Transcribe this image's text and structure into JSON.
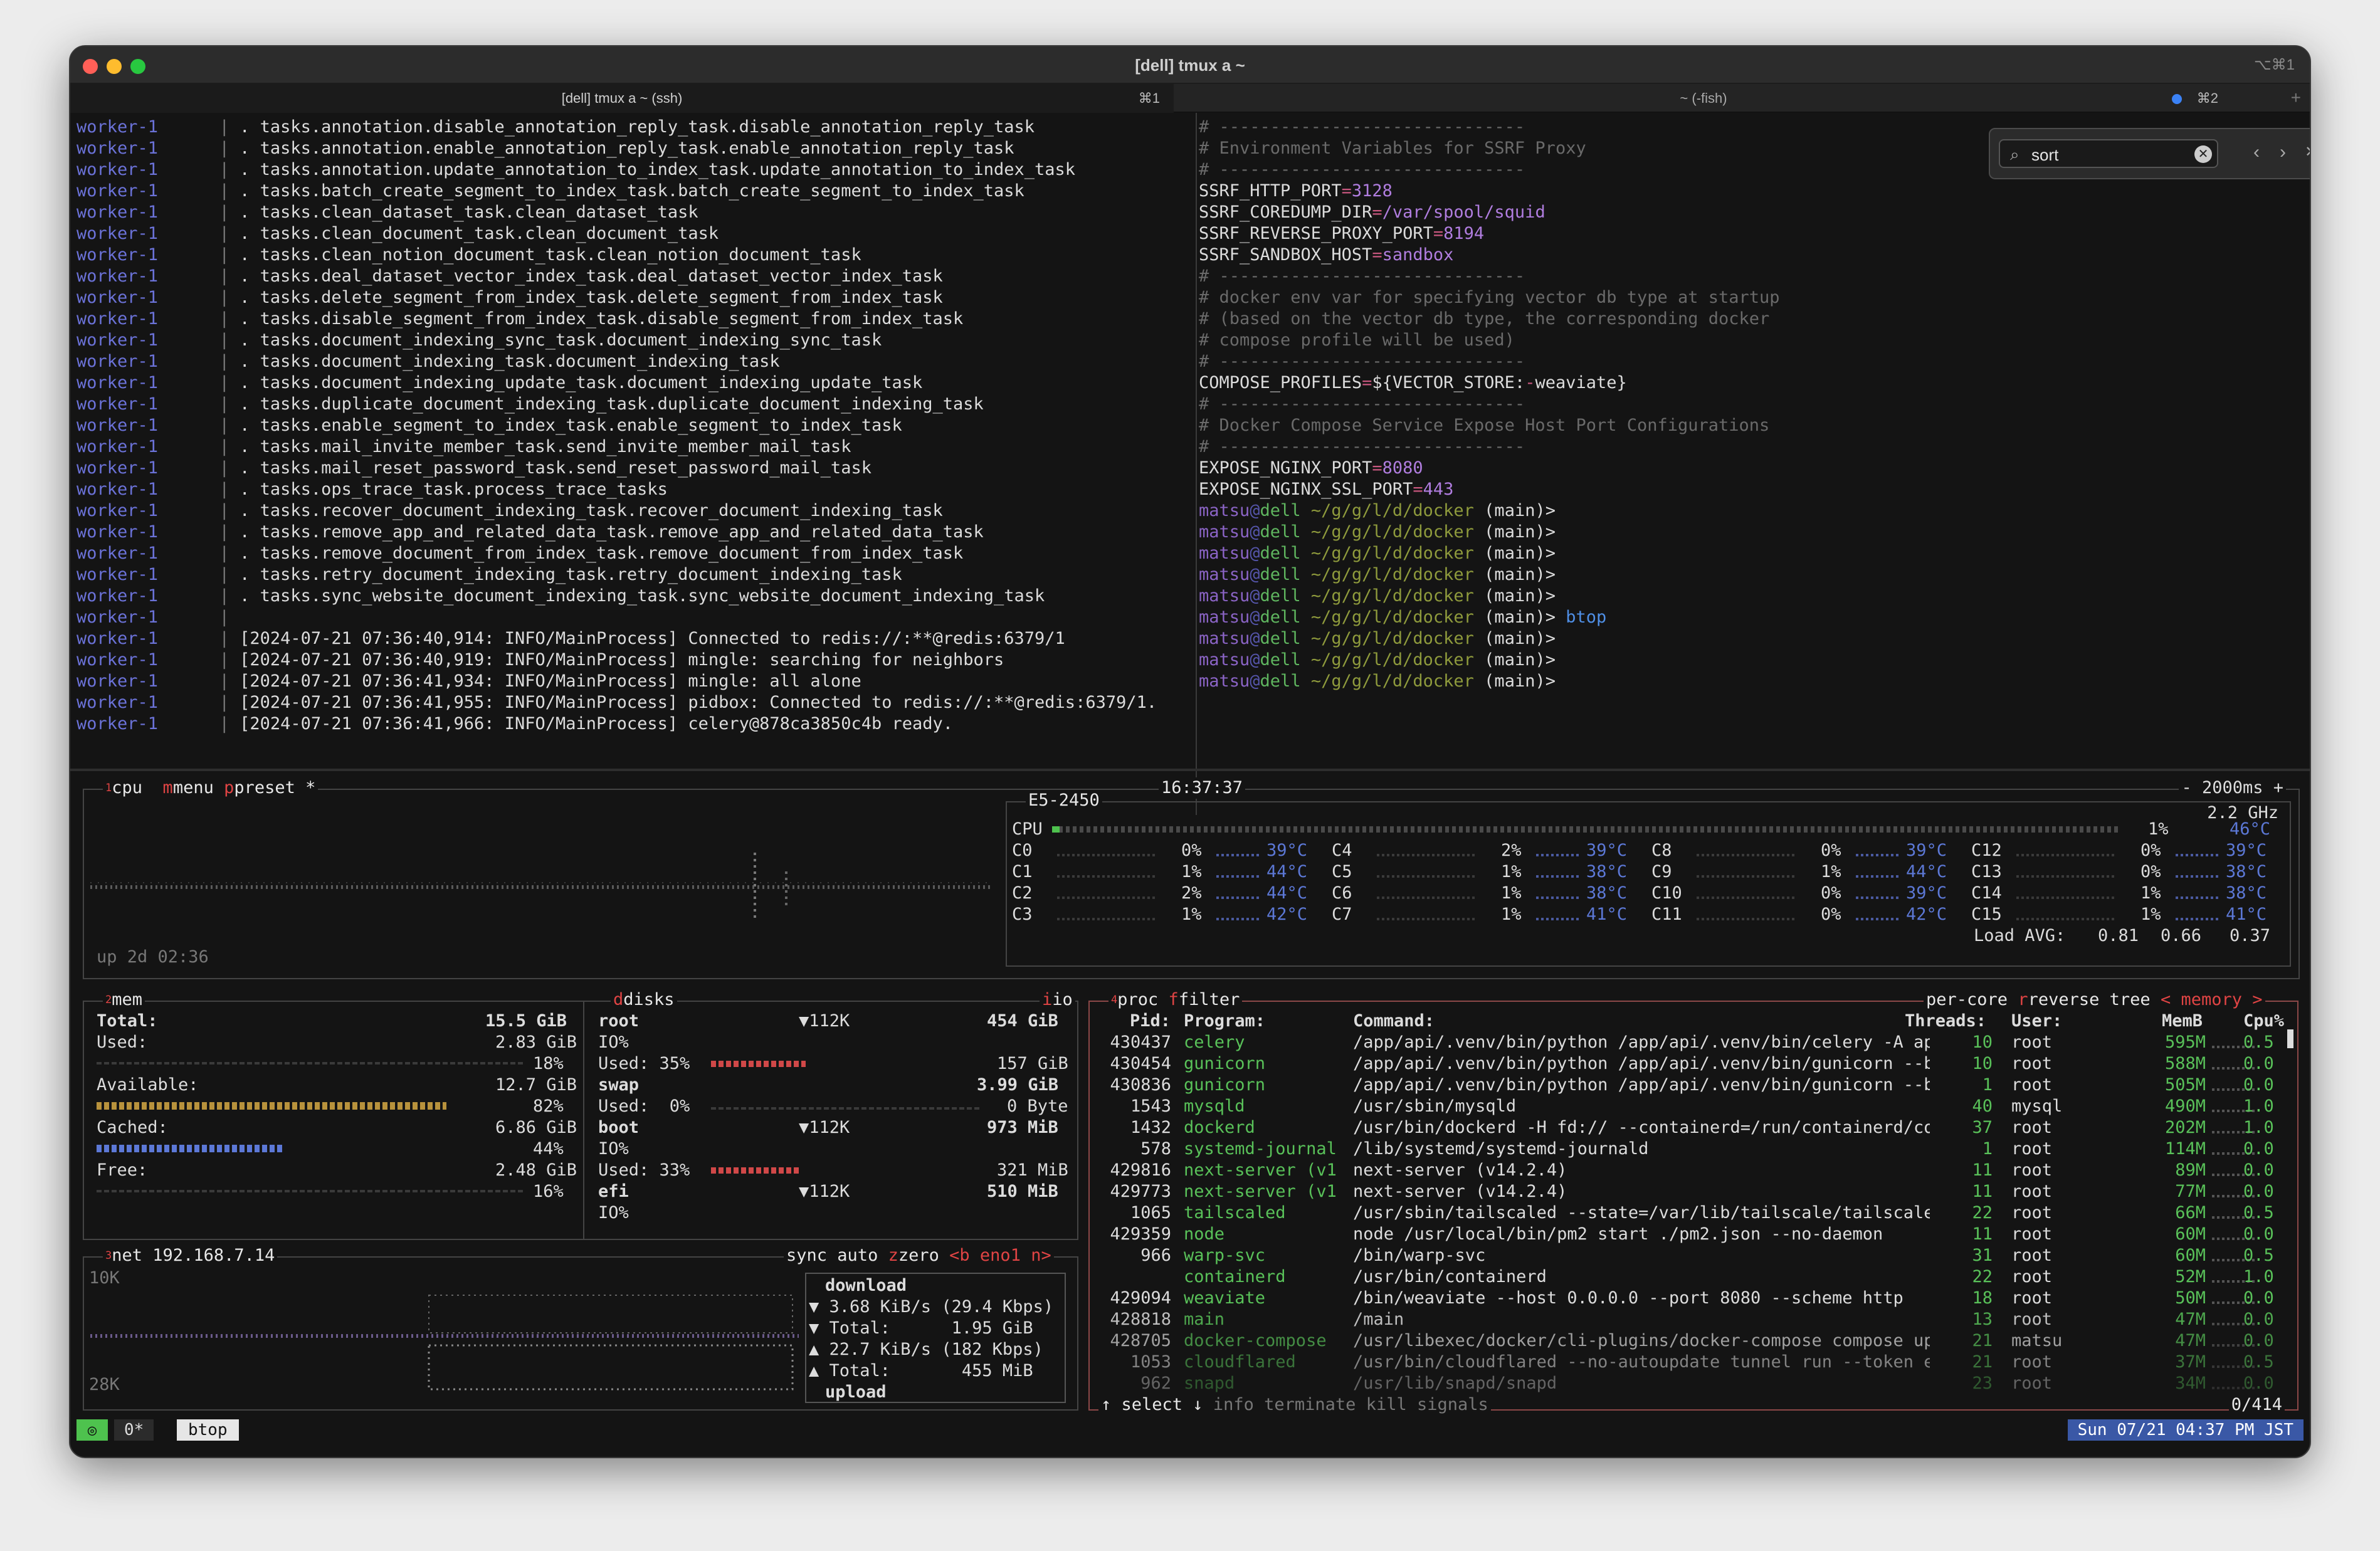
{
  "window": {
    "title": "[dell] tmux a ~",
    "shortcut": "⌥⌘1"
  },
  "tabs": [
    {
      "label": "[dell] tmux a ~ (ssh)",
      "key": "⌘1"
    },
    {
      "label": "~ (-fish)",
      "key": "⌘2"
    }
  ],
  "tab_plus": "+",
  "search": {
    "value": "sort",
    "clear": "✕",
    "prev": "‹",
    "next": "›",
    "close": "✕"
  },
  "left_pane": {
    "prefix": "worker-1",
    "sep": "|",
    "tasks": [
      ". tasks.annotation.disable_annotation_reply_task.disable_annotation_reply_task",
      ". tasks.annotation.enable_annotation_reply_task.enable_annotation_reply_task",
      ". tasks.annotation.update_annotation_to_index_task.update_annotation_to_index_task",
      ". tasks.batch_create_segment_to_index_task.batch_create_segment_to_index_task",
      ". tasks.clean_dataset_task.clean_dataset_task",
      ". tasks.clean_document_task.clean_document_task",
      ". tasks.clean_notion_document_task.clean_notion_document_task",
      ". tasks.deal_dataset_vector_index_task.deal_dataset_vector_index_task",
      ". tasks.delete_segment_from_index_task.delete_segment_from_index_task",
      ". tasks.disable_segment_from_index_task.disable_segment_from_index_task",
      ". tasks.document_indexing_sync_task.document_indexing_sync_task",
      ". tasks.document_indexing_task.document_indexing_task",
      ". tasks.document_indexing_update_task.document_indexing_update_task",
      ". tasks.duplicate_document_indexing_task.duplicate_document_indexing_task",
      ". tasks.enable_segment_to_index_task.enable_segment_to_index_task",
      ". tasks.mail_invite_member_task.send_invite_member_mail_task",
      ". tasks.mail_reset_password_task.send_reset_password_mail_task",
      ". tasks.ops_trace_task.process_trace_tasks",
      ". tasks.recover_document_indexing_task.recover_document_indexing_task",
      ". tasks.remove_app_and_related_data_task.remove_app_and_related_data_task",
      ". tasks.remove_document_from_index_task.remove_document_from_index_task",
      ". tasks.retry_document_indexing_task.retry_document_indexing_task",
      ". tasks.sync_website_document_indexing_task.sync_website_document_indexing_task",
      "",
      "[2024-07-21 07:36:40,914: INFO/MainProcess] Connected to redis://:**@redis:6379/1",
      "[2024-07-21 07:36:40,919: INFO/MainProcess] mingle: searching for neighbors",
      "[2024-07-21 07:36:41,934: INFO/MainProcess] mingle: all alone",
      "[2024-07-21 07:36:41,955: INFO/MainProcess] pidbox: Connected to redis://:**@redis:6379/1.",
      "[2024-07-21 07:36:41,966: INFO/MainProcess] celery@878ca3850c4b ready."
    ]
  },
  "right_pane": {
    "rule": "# ------------------------------",
    "c1": "# Environment Variables for SSRF Proxy",
    "env1": [
      {
        "k": "SSRF_HTTP_PORT",
        "v": "3128"
      },
      {
        "k": "SSRF_COREDUMP_DIR",
        "v": "/var/spool/squid"
      },
      {
        "k": "SSRF_REVERSE_PROXY_PORT",
        "v": "8194"
      },
      {
        "k": "SSRF_SANDBOX_HOST",
        "v": "sandbox"
      }
    ],
    "c2": [
      "# docker env var for specifying vector db type at startup",
      "# (based on the vector db type, the corresponding docker",
      "# compose profile will be used)"
    ],
    "profiles_k": "COMPOSE_PROFILES",
    "profiles_v1": "${VECTOR_STORE:",
    "profiles_v2": "-",
    "profiles_v3": "weaviate}",
    "c3": "# Docker Compose Service Expose Host Port Configurations",
    "env2": [
      {
        "k": "EXPOSE_NGINX_PORT",
        "v": "8080"
      },
      {
        "k": "EXPOSE_NGINX_SSL_PORT",
        "v": "443"
      }
    ],
    "prompt_user": "matsu",
    "prompt_host": "dell",
    "prompt_path": " ~/g/g/l/d/docker",
    "prompt_branch": " (main)>",
    "prompt_cmds": [
      "",
      "",
      "",
      "",
      "",
      "btop",
      "",
      "",
      ""
    ]
  },
  "btop": {
    "cpu": {
      "label_num": "1",
      "label": "cpu",
      "menu": "menu",
      "preset": "preset *",
      "clock": "16:37:37",
      "interval": "- 2000ms +",
      "model": "E5-2450",
      "freq": "2.2 GHz",
      "total": {
        "name": "CPU",
        "pct": "1%",
        "temp": "46°C"
      },
      "cores": [
        {
          "n": "C0",
          "p": "0%",
          "t": "39°C"
        },
        {
          "n": "C1",
          "p": "1%",
          "t": "44°C"
        },
        {
          "n": "C2",
          "p": "2%",
          "t": "44°C"
        },
        {
          "n": "C3",
          "p": "1%",
          "t": "42°C"
        },
        {
          "n": "C4",
          "p": "2%",
          "t": "39°C"
        },
        {
          "n": "C5",
          "p": "1%",
          "t": "38°C"
        },
        {
          "n": "C6",
          "p": "1%",
          "t": "38°C"
        },
        {
          "n": "C7",
          "p": "1%",
          "t": "41°C"
        },
        {
          "n": "C8",
          "p": "0%",
          "t": "39°C"
        },
        {
          "n": "C9",
          "p": "1%",
          "t": "44°C"
        },
        {
          "n": "C10",
          "p": "0%",
          "t": "39°C"
        },
        {
          "n": "C11",
          "p": "0%",
          "t": "42°C"
        },
        {
          "n": "C12",
          "p": "0%",
          "t": "39°C"
        },
        {
          "n": "C13",
          "p": "0%",
          "t": "38°C"
        },
        {
          "n": "C14",
          "p": "1%",
          "t": "38°C"
        },
        {
          "n": "C15",
          "p": "1%",
          "t": "41°C"
        }
      ],
      "load_label": "Load AVG:",
      "load": [
        "0.81",
        "0.66",
        "0.37"
      ],
      "uptime": "up 2d 02:36"
    },
    "mem": {
      "label_num": "2",
      "label": "mem",
      "total_label": "Total:",
      "total": "15.5 GiB",
      "used_label": "Used:",
      "used": "2.83 GiB",
      "used_pct": "18%",
      "avail_label": "Available:",
      "avail": "12.7 GiB",
      "avail_pct": "82%",
      "cached_label": "Cached:",
      "cached": "6.86 GiB",
      "cached_pct": "44%",
      "free_label": "Free:",
      "free": "2.48 GiB",
      "free_pct": "16%"
    },
    "disks": {
      "label": "disks",
      "io": "io",
      "items": [
        {
          "name": "root",
          "io_rate": "▼112K",
          "size": "454 GiB",
          "io": "IO%",
          "used_label": "Used: 35%",
          "used": "157 GiB"
        },
        {
          "name": "swap",
          "size": "3.99 GiB",
          "used_label": "Used:  0%",
          "used": "0 Byte"
        },
        {
          "name": "boot",
          "io_rate": "▼112K",
          "size": "973 MiB",
          "io": "IO%",
          "used_label": "Used: 33%",
          "used": "321 MiB"
        },
        {
          "name": "efi",
          "io_rate": "▼112K",
          "size": "510 MiB",
          "io": "IO%"
        }
      ]
    },
    "net": {
      "label_num": "3",
      "label": "net",
      "ip": "192.168.7.14",
      "sync": "sync",
      "auto": "auto",
      "zero": "zero",
      "iface": "<b eno1 n>",
      "scale_top": "10K",
      "scale_bot": "28K",
      "download": "download",
      "dl_rate": "▼ 3.68 KiB/s (29.4 Kbps)",
      "dl_total": "▼ Total:      1.95 GiB",
      "ul_rate": "▲ 22.7 KiB/s (182 Kbps)",
      "ul_total": "▲ Total:       455 MiB",
      "upload": "upload"
    },
    "proc": {
      "label_num": "4",
      "label": "proc",
      "filter": "filter",
      "per_core": "per-core",
      "reverse": "reverse",
      "tree": "tree",
      "sort": "< memory >",
      "headers": {
        "pid": "Pid:",
        "program": "Program:",
        "command": "Command:",
        "threads": "Threads:",
        "user": "User:",
        "memb": "MemB",
        "cpu": "Cpu%"
      },
      "rows": [
        {
          "pid": "430437",
          "prog": "celery",
          "cmd": "/app/api/.venv/bin/python /app/api/.venv/bin/celery -A app.",
          "thr": "10",
          "user": "root",
          "mem": "595M",
          "cpu": "0.5"
        },
        {
          "pid": "430454",
          "prog": "gunicorn",
          "cmd": "/app/api/.venv/bin/python /app/api/.venv/bin/gunicorn --bin",
          "thr": "10",
          "user": "root",
          "mem": "588M",
          "cpu": "0.0"
        },
        {
          "pid": "430836",
          "prog": "gunicorn",
          "cmd": "/app/api/.venv/bin/python /app/api/.venv/bin/gunicorn --bin",
          "thr": "1",
          "user": "root",
          "mem": "505M",
          "cpu": "0.0"
        },
        {
          "pid": "1543",
          "prog": "mysqld",
          "cmd": "/usr/sbin/mysqld",
          "thr": "40",
          "user": "mysql",
          "mem": "490M",
          "cpu": "1.0"
        },
        {
          "pid": "1432",
          "prog": "dockerd",
          "cmd": "/usr/bin/dockerd -H fd:// --containerd=/run/containerd/cont",
          "thr": "37",
          "user": "root",
          "mem": "202M",
          "cpu": "1.0"
        },
        {
          "pid": "578",
          "prog": "systemd-journal",
          "cmd": "/lib/systemd/systemd-journald",
          "thr": "1",
          "user": "root",
          "mem": "114M",
          "cpu": "0.0"
        },
        {
          "pid": "429816",
          "prog": "next-server (v1",
          "cmd": "next-server (v14.2.4)",
          "thr": "11",
          "user": "root",
          "mem": "89M",
          "cpu": "0.0"
        },
        {
          "pid": "429773",
          "prog": "next-server (v1",
          "cmd": "next-server (v14.2.4)",
          "thr": "11",
          "user": "root",
          "mem": "77M",
          "cpu": "0.0"
        },
        {
          "pid": "1065",
          "prog": "tailscaled",
          "cmd": "/usr/sbin/tailscaled --state=/var/lib/tailscale/tailscaled.",
          "thr": "22",
          "user": "root",
          "mem": "66M",
          "cpu": "0.5"
        },
        {
          "pid": "429359",
          "prog": "node",
          "cmd": "node /usr/local/bin/pm2 start ./pm2.json --no-daemon",
          "thr": "11",
          "user": "root",
          "mem": "60M",
          "cpu": "0.0"
        },
        {
          "pid": "966",
          "prog": "warp-svc",
          "cmd": "/bin/warp-svc",
          "thr": "31",
          "user": "root",
          "mem": "60M",
          "cpu": "0.5"
        },
        {
          "pid": "",
          "prog": "containerd",
          "cmd": "/usr/bin/containerd",
          "thr": "22",
          "user": "root",
          "mem": "52M",
          "cpu": "1.0"
        },
        {
          "pid": "429094",
          "prog": "weaviate",
          "cmd": "/bin/weaviate --host 0.0.0.0 --port 8080 --scheme http",
          "thr": "18",
          "user": "root",
          "mem": "50M",
          "cpu": "0.0"
        },
        {
          "pid": "428818",
          "prog": "main",
          "cmd": "/main",
          "thr": "13",
          "user": "root",
          "mem": "47M",
          "cpu": "0.0"
        },
        {
          "pid": "428705",
          "prog": "docker-compose",
          "cmd": "/usr/libexec/docker/cli-plugins/docker-compose compose up",
          "thr": "21",
          "user": "matsu",
          "mem": "47M",
          "cpu": "0.0"
        },
        {
          "pid": "1053",
          "prog": "cloudflared",
          "cmd": "/usr/bin/cloudflared --no-autoupdate tunnel run --token eyJ",
          "thr": "21",
          "user": "root",
          "mem": "37M",
          "cpu": "0.5"
        },
        {
          "pid": "962",
          "prog": "snapd",
          "cmd": "/usr/lib/snapd/snapd",
          "thr": "23",
          "user": "root",
          "mem": "34M",
          "cpu": "0.0"
        }
      ],
      "footer": {
        "select": "↑ select ↓",
        "info": "info",
        "terminate": "terminate",
        "kill": "kill",
        "signals": "signals",
        "count": "0/414"
      }
    }
  },
  "statusbar": {
    "icon": "◎",
    "window": "0*",
    "name": "btop",
    "datetime": "Sun 07/21 04:37 PM JST"
  }
}
